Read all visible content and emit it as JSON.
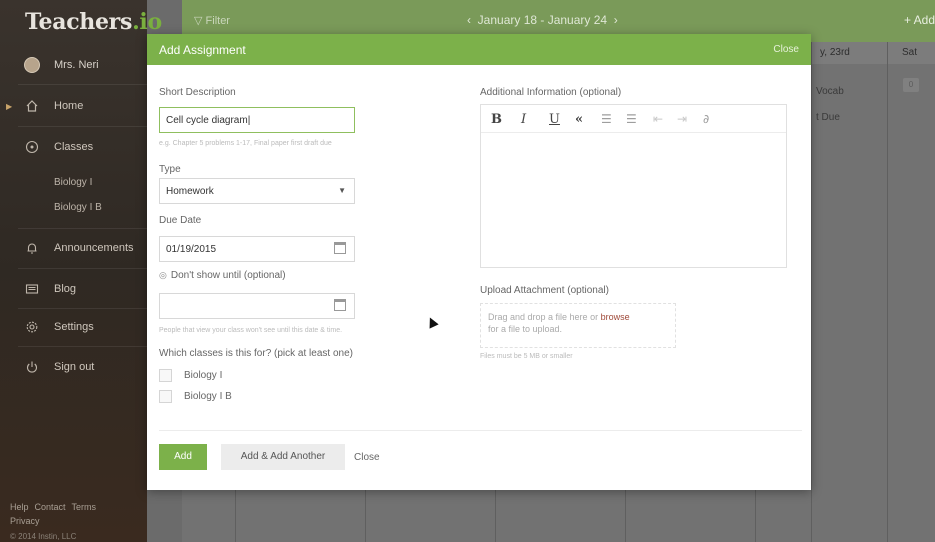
{
  "sidebar": {
    "logo_main": "Teachers",
    "logo_suffix": ".io",
    "user_name": "Mrs. Neri",
    "items": [
      {
        "label": "Home"
      },
      {
        "label": "Classes"
      },
      {
        "label": "Announcements"
      },
      {
        "label": "Blog"
      },
      {
        "label": "Settings"
      },
      {
        "label": "Sign out"
      }
    ],
    "classes": [
      "Biology I",
      "Biology I B"
    ],
    "footer": {
      "help": "Help",
      "contact": "Contact",
      "terms": "Terms",
      "privacy": "Privacy"
    },
    "copyright": "© 2014 Instin, LLC"
  },
  "topbar": {
    "filter_label": "Filter",
    "date_range": "January 18 - January 24",
    "add_label": "+ Add"
  },
  "calendar": {
    "headers": [
      {
        "label": "y, 23rd"
      },
      {
        "label": "Sat"
      }
    ],
    "events": [
      "Vocab",
      "t Due"
    ],
    "badge": "0"
  },
  "modal": {
    "title": "Add Assignment",
    "close_top": "Close",
    "short_desc_label": "Short Description",
    "short_desc_value": "Cell cycle diagram",
    "short_desc_hint": "e.g. Chapter 5 problems 1-17, Final paper first draft due",
    "type_label": "Type",
    "type_value": "Homework",
    "due_label": "Due Date",
    "due_value": "01/19/2015",
    "dont_show_label": "Don't show until (optional)",
    "dont_show_value": "",
    "dont_show_hint": "People that view your class won't see until this date & time.",
    "classes_label": "Which classes is this for? (pick at least one)",
    "class_options": [
      {
        "label": "Biology I",
        "checked": false
      },
      {
        "label": "Biology I B",
        "checked": false
      }
    ],
    "additional_label": "Additional Information (optional)",
    "upload_label": "Upload Attachment (optional)",
    "drop_text": "Drag and drop a file here or",
    "browse": "browse",
    "drop_text2": "for a file to upload.",
    "file_hint": "Files must be 5 MB or smaller",
    "add_button": "Add",
    "add_another_button": "Add & Add Another",
    "close_button": "Close"
  },
  "colors": {
    "accent_green": "#7cb14a",
    "sidebar_bg": "#3a332d",
    "link_red": "#a04a3a"
  }
}
